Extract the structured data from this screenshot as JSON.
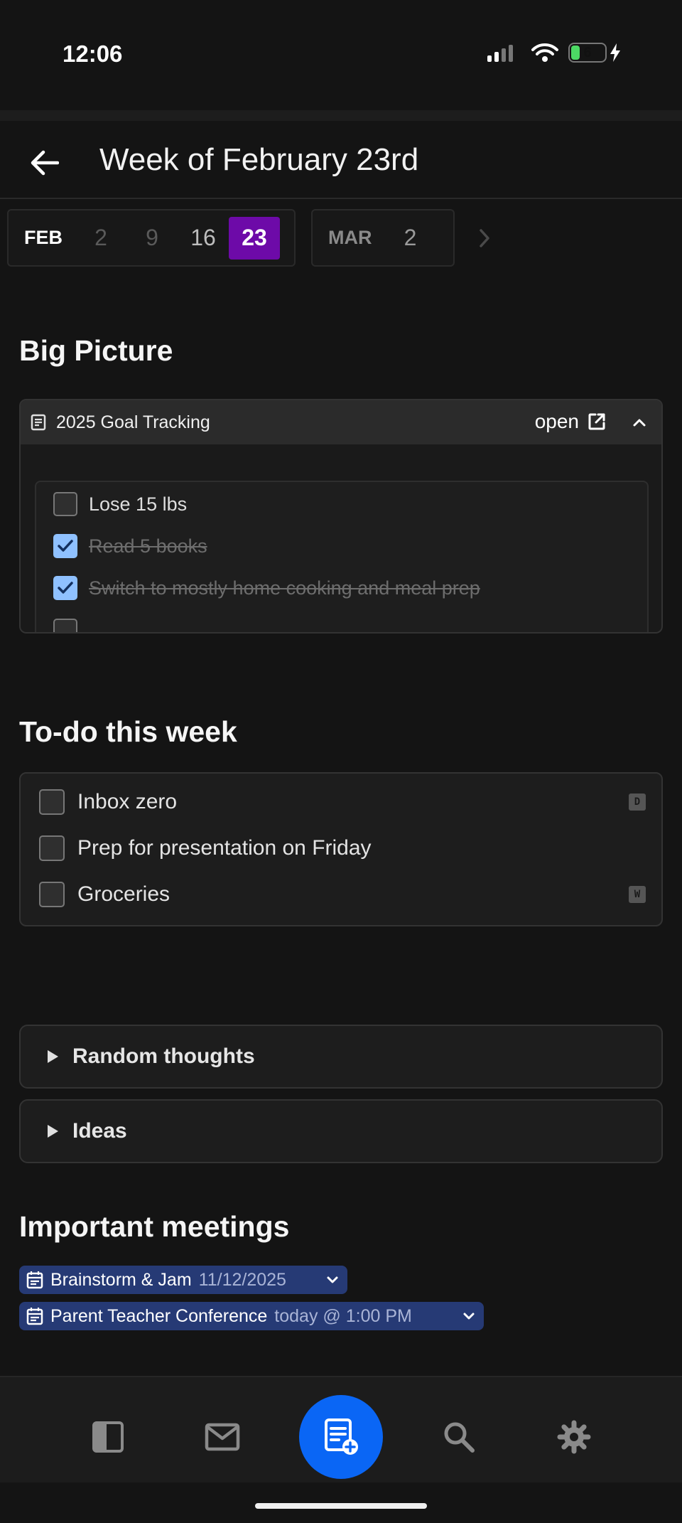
{
  "status_bar": {
    "time": "12:06",
    "battery_level": "6"
  },
  "header": {
    "title": "Week of February 23rd"
  },
  "week_nav": {
    "groups": [
      {
        "month": "FEB",
        "days": [
          "2",
          "9",
          "16",
          "23"
        ],
        "selected": "23"
      },
      {
        "month": "MAR",
        "days": [
          "2"
        ]
      }
    ]
  },
  "big_picture": {
    "title": "Big Picture",
    "doc_title": "2025 Goal Tracking",
    "open_label": "open",
    "goals": [
      {
        "text": "Lose 15 lbs",
        "checked": false
      },
      {
        "text": "Read 5 books",
        "checked": true
      },
      {
        "text": "Switch to mostly home cooking and meal prep",
        "checked": true
      }
    ]
  },
  "todo": {
    "title": "To-do this week",
    "items": [
      {
        "text": "Inbox zero",
        "tag": "D"
      },
      {
        "text": "Prep for presentation on Friday",
        "tag": ""
      },
      {
        "text": "Groceries",
        "tag": "W"
      }
    ]
  },
  "toggles": [
    {
      "label": "Random thoughts"
    },
    {
      "label": "Ideas"
    }
  ],
  "meetings": {
    "title": "Important meetings",
    "items": [
      {
        "name": "Brainstorm & Jam",
        "when": "11/12/2025"
      },
      {
        "name": "Parent Teacher Conference",
        "when": "today @ 1:00 PM"
      }
    ]
  },
  "icons": {
    "back": "arrow-left-icon",
    "doc": "document-icon",
    "external": "external-link-icon",
    "collapse": "chevron-up-icon",
    "calendar": "calendar-icon",
    "nav": [
      "sidebar-icon",
      "mail-icon",
      "new-note-icon",
      "search-icon",
      "gear-icon"
    ]
  },
  "colors": {
    "selected_day": "#6d0aa8",
    "fab": "#0a66f5",
    "chip": "#263a75",
    "checkbox_checked": "#8fc1ff"
  }
}
